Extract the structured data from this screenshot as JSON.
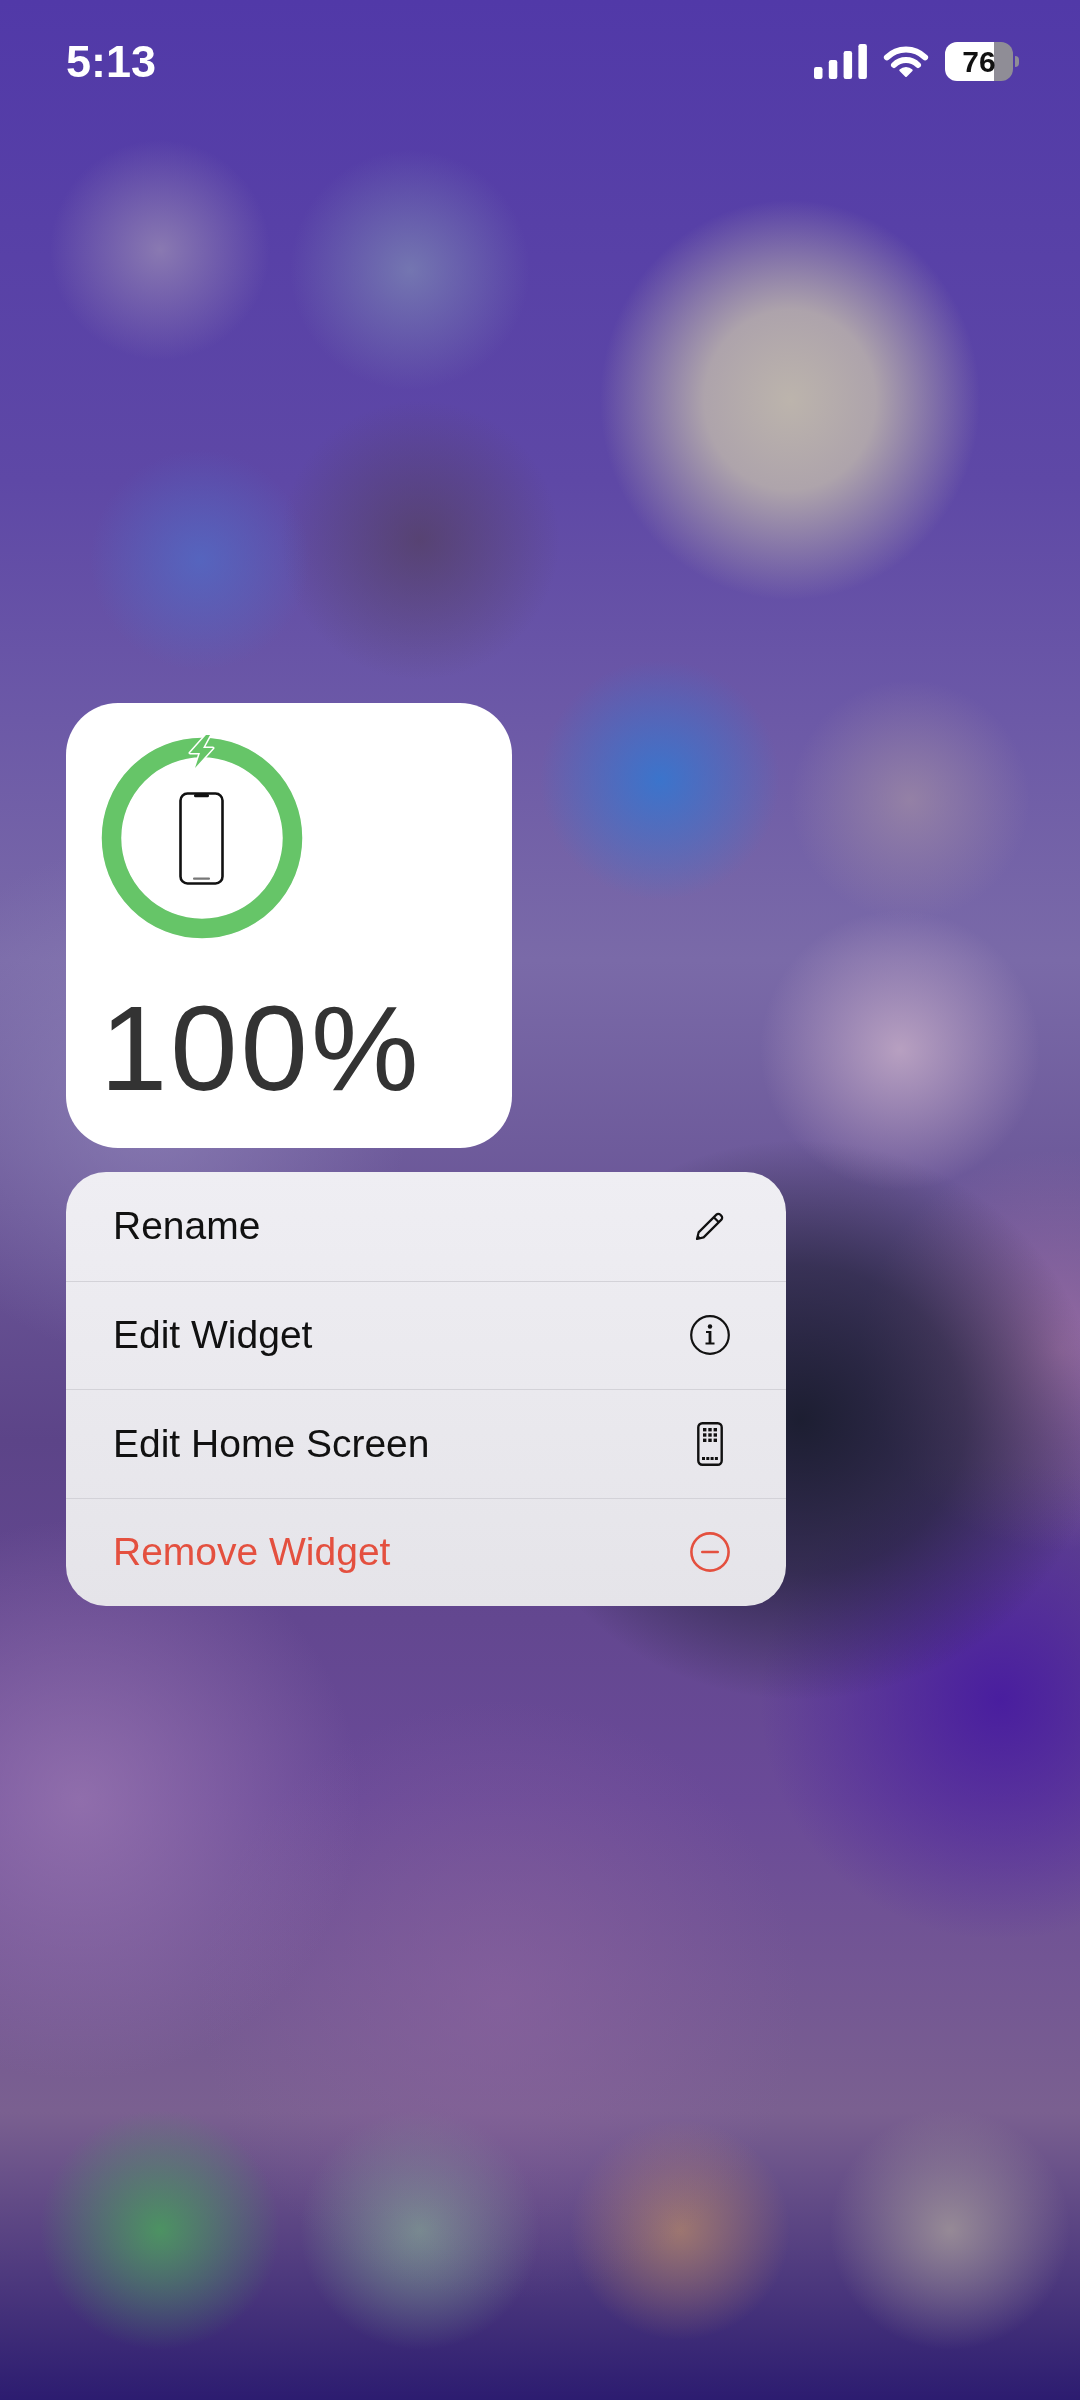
{
  "status_bar": {
    "time": "5:13",
    "battery": "76"
  },
  "widget": {
    "level": 1,
    "charging": true,
    "percent": "100%"
  },
  "context_menu": {
    "items": [
      {
        "label": "Rename",
        "destructive": false
      },
      {
        "label": "Edit Widget",
        "destructive": false
      },
      {
        "label": "Edit Home Screen",
        "destructive": false
      },
      {
        "label": "Remove Widget",
        "destructive": true
      }
    ]
  }
}
